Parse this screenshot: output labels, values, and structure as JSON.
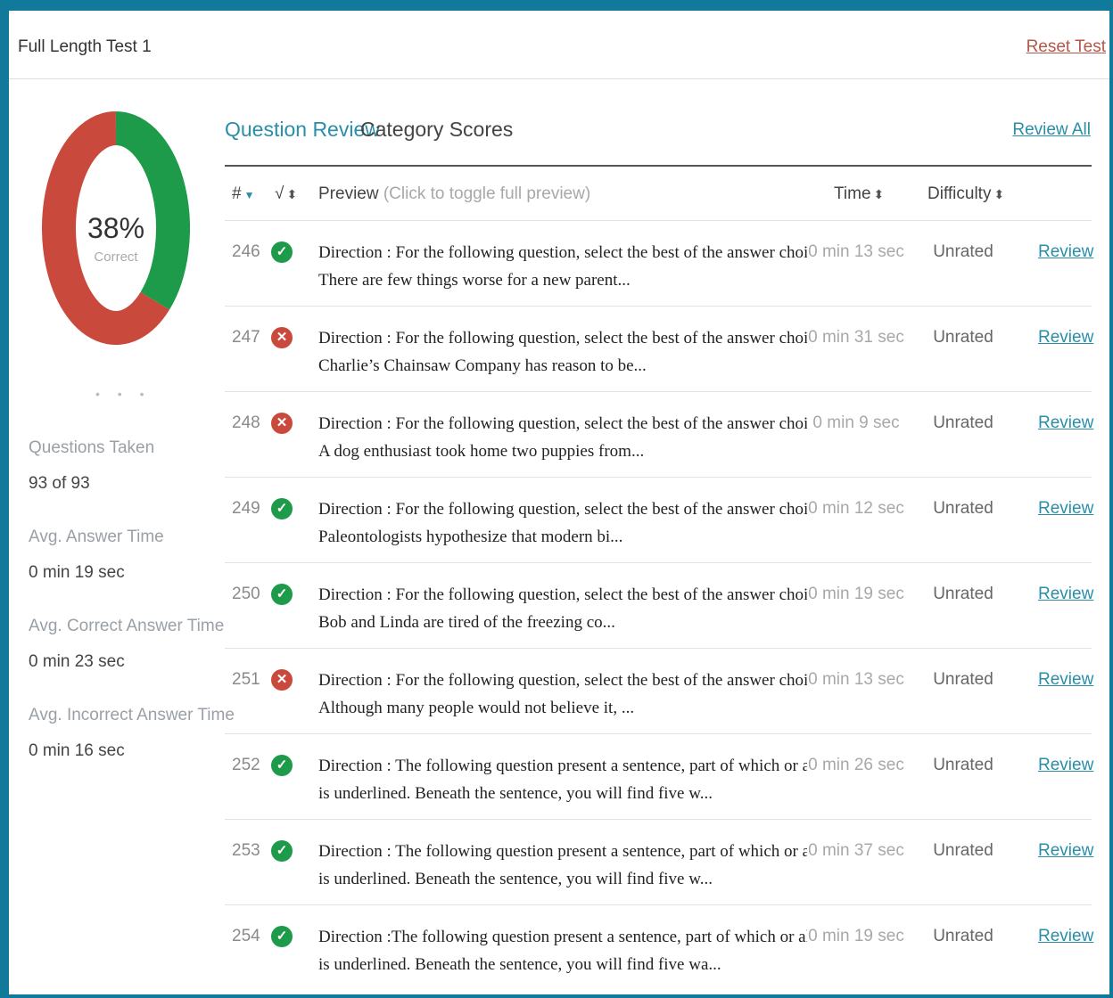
{
  "header": {
    "title": "Full Length Test 1",
    "reset_label": "Reset Test"
  },
  "summary": {
    "percent_correct": "38%",
    "percent_value": 0.38,
    "correct_label": "Correct",
    "colors": {
      "correct": "#1e9a4b",
      "incorrect": "#c94a3c"
    },
    "dots": "• • •",
    "stats": [
      {
        "label": "Questions Taken",
        "value": "93 of 93"
      },
      {
        "label": "Avg. Answer Time",
        "value": "0 min 19 sec"
      },
      {
        "label": "Avg. Correct Answer Time",
        "value": "0 min 23 sec"
      },
      {
        "label": "Avg. Incorrect Answer Time",
        "value": "0 min 16 sec"
      }
    ]
  },
  "tabs": {
    "question_review": "Question Review",
    "category_scores": "Category Scores"
  },
  "review_all_label": "Review All",
  "table": {
    "headers": {
      "num": "#",
      "check": "√",
      "preview": "Preview",
      "preview_hint": "(Click to toggle full preview)",
      "time": "Time",
      "difficulty": "Difficulty"
    },
    "rows": [
      {
        "num": "246",
        "status": "correct",
        "line1": "Direction : For the following question, select the best of the answer choices given.",
        "line2": "There are few things worse for a new parent...",
        "time": "0 min 13 sec",
        "difficulty": "Unrated",
        "action": "Review"
      },
      {
        "num": "247",
        "status": "incorrect",
        "line1": "Direction : For the following question, select the best of the answer choices given.",
        "line2": "Charlie’s Chainsaw Company has reason to be...",
        "time": "0 min 31 sec",
        "difficulty": "Unrated",
        "action": "Review"
      },
      {
        "num": "248",
        "status": "incorrect",
        "line1": "Direction : For the following question, select the best of the answer choices given.",
        "line2": "A dog enthusiast took home two puppies from...",
        "time": "0 min 9 sec",
        "difficulty": "Unrated",
        "action": "Review"
      },
      {
        "num": "249",
        "status": "correct",
        "line1": "Direction : For the following question, select the best of the answer choices given.",
        "line2": "Paleontologists hypothesize that modern bi...",
        "time": "0 min 12 sec",
        "difficulty": "Unrated",
        "action": "Review"
      },
      {
        "num": "250",
        "status": "correct",
        "line1": "Direction : For the following question, select the best of the answer choices given.",
        "line2": "Bob and Linda are tired of the freezing co...",
        "time": "0 min 19 sec",
        "difficulty": "Unrated",
        "action": "Review"
      },
      {
        "num": "251",
        "status": "incorrect",
        "line1": "Direction : For the following question, select the best of the answer choices given.",
        "line2": "Although many people would not believe it, ...",
        "time": "0 min 13 sec",
        "difficulty": "Unrated",
        "action": "Review"
      },
      {
        "num": "252",
        "status": "correct",
        "line1": "Direction : The following question present a sentence, part of which or all of which",
        "line2": "is underlined. Beneath the sentence, you will find five w...",
        "time": "0 min 26 sec",
        "difficulty": "Unrated",
        "action": "Review"
      },
      {
        "num": "253",
        "status": "correct",
        "line1": "Direction : The following question present a sentence, part of which or all of which",
        "line2": "is underlined. Beneath the sentence, you will find five w...",
        "time": "0 min 37 sec",
        "difficulty": "Unrated",
        "action": "Review"
      },
      {
        "num": "254",
        "status": "correct",
        "line1": "Direction :The following question present a sentence, part of which or all of which",
        "line2": "is underlined. Beneath the sentence, you will find five wa...",
        "time": "0 min 19 sec",
        "difficulty": "Unrated",
        "action": "Review"
      }
    ]
  }
}
